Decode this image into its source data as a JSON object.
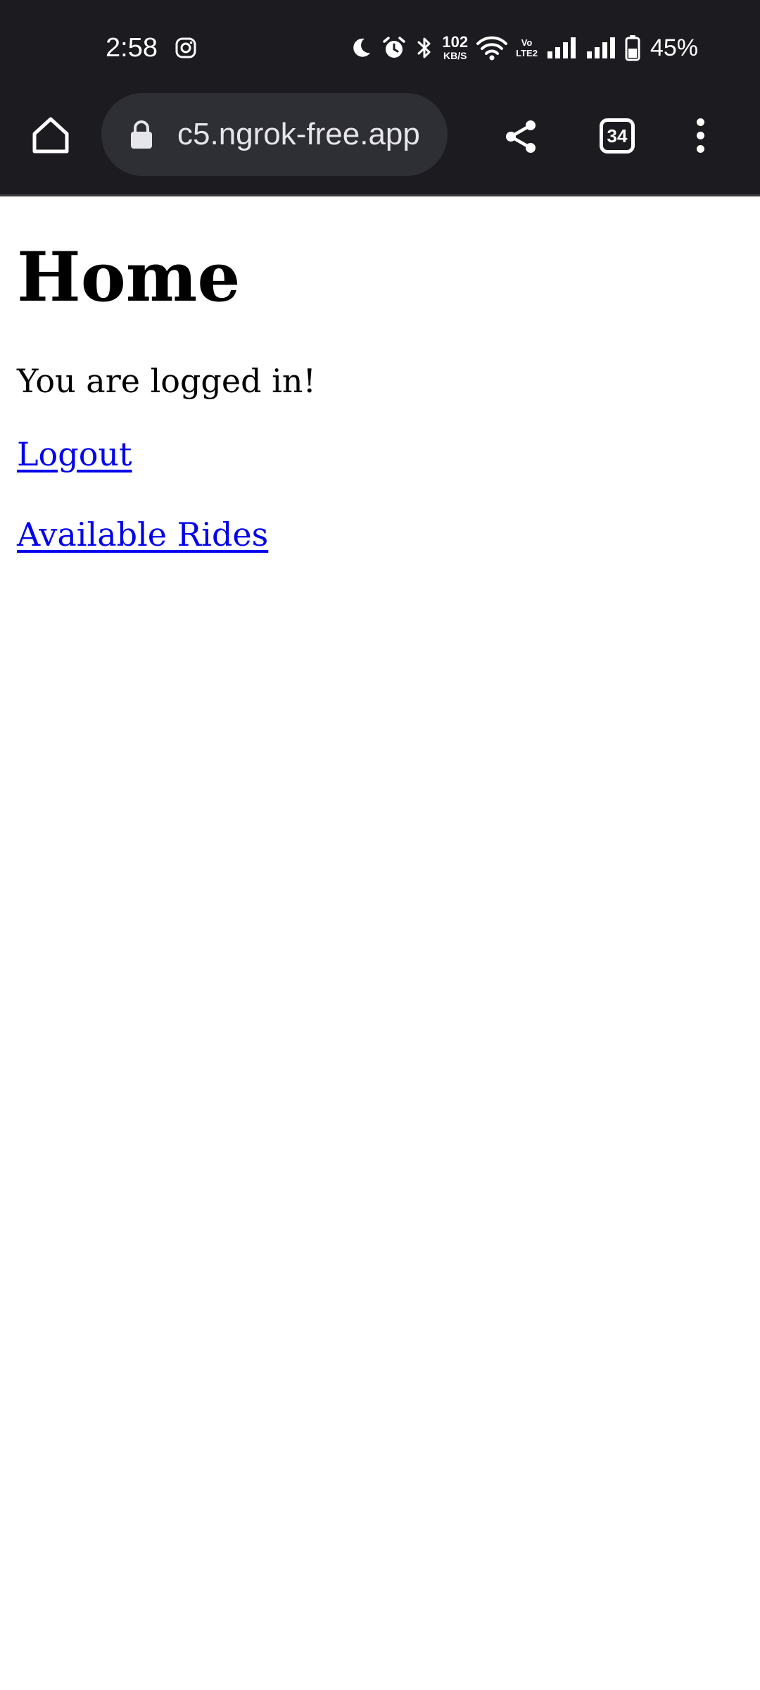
{
  "status_bar": {
    "time": "2:58",
    "network_speed_value": "102",
    "network_speed_unit": "KB/S",
    "volte_top": "Vo",
    "volte_bottom": "LTE2",
    "battery_percent": "45%"
  },
  "browser": {
    "url_text": "c5.ngrok-free.app",
    "tab_count": "34"
  },
  "page": {
    "title": "Home",
    "message": "You are logged in!",
    "links": {
      "logout": "Logout",
      "available_rides": "Available Rides"
    }
  },
  "colors": {
    "chrome_bg": "#1c1b20",
    "url_bar_bg": "#2e2e35",
    "link": "#0000ee",
    "page_bg": "#ffffff"
  },
  "icons": {
    "status_left": [
      "instagram-icon"
    ],
    "status_right": [
      "do-not-disturb-moon-icon",
      "alarm-icon",
      "bluetooth-icon",
      "wifi-icon",
      "signal-sim1-icon",
      "signal-sim2-icon",
      "battery-icon"
    ],
    "toolbar": [
      "home-icon",
      "lock-icon",
      "share-icon",
      "tab-switcher-icon",
      "overflow-menu-icon"
    ]
  }
}
